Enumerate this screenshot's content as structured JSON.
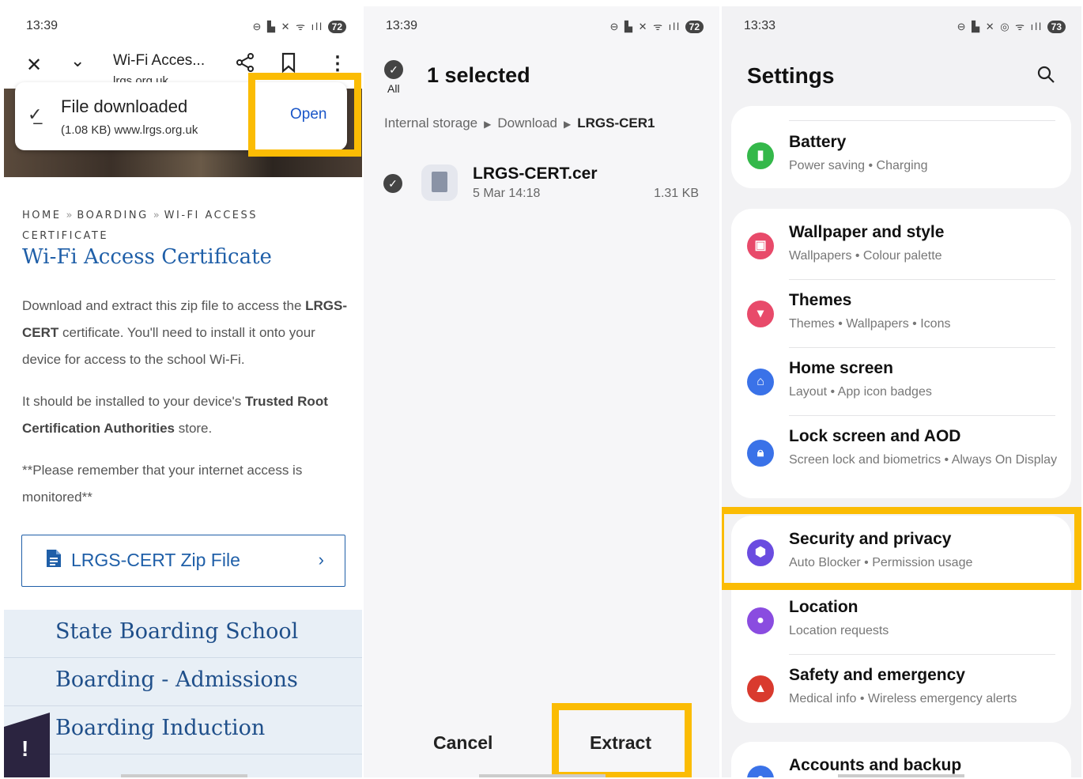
{
  "panel1": {
    "status": {
      "time": "13:39",
      "battery": "72"
    },
    "toolbar": {
      "title": "Wi-Fi Acces...",
      "url": "lrgs.org.uk"
    },
    "download": {
      "title": "File downloaded",
      "detail": "(1.08 KB) www.lrgs.org.uk",
      "open": "Open"
    },
    "breadcrumb": [
      "HOME",
      "BOARDING",
      "WI-FI ACCESS CERTIFICATE"
    ],
    "breadcrumb_sep": "»",
    "heading": "Wi-Fi Access Certificate",
    "para1": {
      "a": "Download and extract this zip file to access the ",
      "b": "LRGS-CERT",
      "c": " certificate. You'll need to install it onto your device for access to the school Wi-Fi."
    },
    "para2": {
      "a": "It should be installed to your device's ",
      "b": "Trusted Root Certification Authorities",
      "c": " store."
    },
    "para3": "**Please remember that your internet access is monitored**",
    "zip_button": "LRGS-CERT Zip File",
    "nav": [
      "State Boarding School",
      "Boarding - Admissions",
      "Boarding Induction"
    ],
    "alert_glyph": "!"
  },
  "panel2": {
    "status": {
      "time": "13:39",
      "battery": "72"
    },
    "select_all_label": "All",
    "selected": "1 selected",
    "path": [
      "Internal storage",
      "Download",
      "LRGS-CER1"
    ],
    "file": {
      "name": "LRGS-CERT.cer",
      "date": "5 Mar 14:18",
      "size": "1.31 KB"
    },
    "cancel": "Cancel",
    "extract": "Extract"
  },
  "panel3": {
    "status": {
      "time": "13:33",
      "battery": "73"
    },
    "title": "Settings",
    "rows": [
      {
        "name": "Battery",
        "sub": "Power saving  •  Charging",
        "color": "#34b84a",
        "icon": "battery-icon"
      },
      {
        "name": "Wallpaper and style",
        "sub": "Wallpapers  •  Colour palette",
        "color": "#e84a6a",
        "icon": "wallpaper-icon"
      },
      {
        "name": "Themes",
        "sub": "Themes  •  Wallpapers  •  Icons",
        "color": "#e84a6a",
        "icon": "themes-icon"
      },
      {
        "name": "Home screen",
        "sub": "Layout  •  App icon badges",
        "color": "#3a72e8",
        "icon": "home-icon"
      },
      {
        "name": "Lock screen and AOD",
        "sub": "Screen lock and biometrics  •  Always On Display",
        "color": "#3a72e8",
        "icon": "lock-icon"
      },
      {
        "name": "Security and privacy",
        "sub": "Auto Blocker  •  Permission usage",
        "color": "#6a4ce0",
        "icon": "shield-icon"
      },
      {
        "name": "Location",
        "sub": "Location requests",
        "color": "#8a4ce0",
        "icon": "location-icon"
      },
      {
        "name": "Safety and emergency",
        "sub": "Medical info  •  Wireless emergency alerts",
        "color": "#d93a2e",
        "icon": "emergency-icon"
      },
      {
        "name": "Accounts and backup",
        "sub": "",
        "color": "#3a72e8",
        "icon": "accounts-icon"
      }
    ]
  },
  "colors": {
    "highlight": "#fbbc04",
    "link": "#1f5fa8",
    "open": "#1a56c8"
  }
}
